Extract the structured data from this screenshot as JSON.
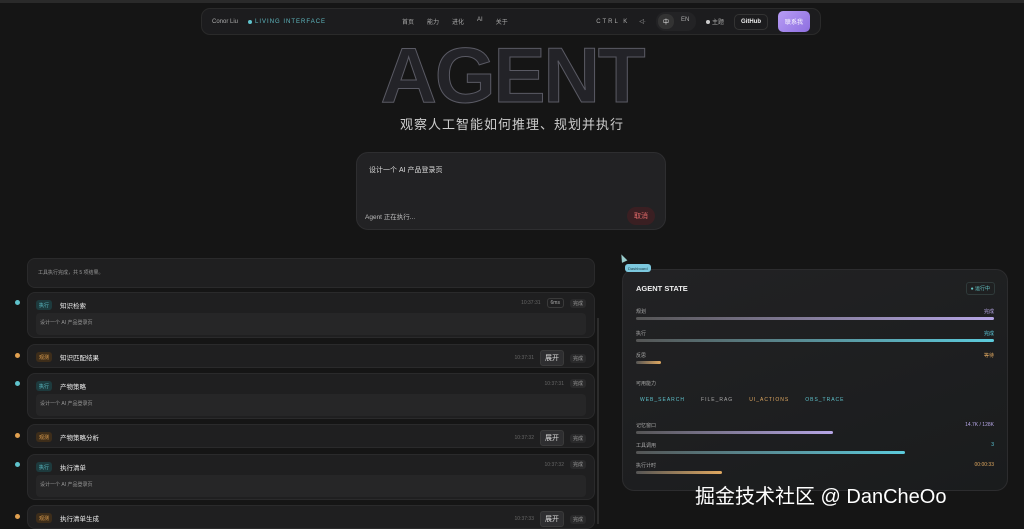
{
  "nav": {
    "brand": "Conor Liu",
    "live": "LIVING INTERFACE",
    "links": [
      "首页",
      "能力",
      "进化",
      "AI",
      "关于"
    ],
    "shortcut": "CTRL  K",
    "sound": "◁·",
    "lang": [
      "中",
      "EN"
    ],
    "theme": "主题",
    "github": "GitHub",
    "cta": "联系我"
  },
  "hero": {
    "title": "AGENT",
    "subtitle": "观察人工智能如何推理、规划并执行"
  },
  "prompt": {
    "value": "设计一个 AI 产品登录页",
    "status": "Agent 正在执行...",
    "cancel": "取消"
  },
  "timeline": [
    {
      "body": "工具执行完成，共 5 项结果。"
    },
    {
      "badge": "执行",
      "title": "知识检索",
      "time": "10:37:31",
      "duration": "6ms",
      "status": "完成",
      "body": "设计一个 AI 产品登录页"
    },
    {
      "badge": "观测",
      "title": "知识匹配结果",
      "time": "10:37:31",
      "action": "展开",
      "status": "完成"
    },
    {
      "badge": "执行",
      "title": "产物策略",
      "time": "10:37:31",
      "status": "完成",
      "body": "设计一个 AI 产品登录页"
    },
    {
      "badge": "观测",
      "title": "产物策略分析",
      "time": "10:37:32",
      "action": "展开",
      "status": "完成"
    },
    {
      "badge": "执行",
      "title": "执行清单",
      "time": "10:37:32",
      "status": "完成",
      "body": "设计一个 AI 产品登录页"
    },
    {
      "badge": "观测",
      "title": "执行清单生成",
      "time": "10:37:33",
      "action": "展开",
      "status": "完成"
    }
  ],
  "state": {
    "tag": "Dashboard",
    "title": "AGENT STATE",
    "running": "运行中",
    "phases": [
      {
        "label": "规划",
        "status": "完成",
        "progress": 100,
        "color": "#b6a6e6"
      },
      {
        "label": "执行",
        "status": "完成",
        "progress": 100,
        "color": "#5ccbdc"
      },
      {
        "label": "反思",
        "status": "等待",
        "progress": 7,
        "color": "#e0a860"
      }
    ],
    "caps_label": "可用能力",
    "caps": [
      {
        "name": "WEB_SEARCH",
        "color": "#5fc3cc"
      },
      {
        "name": "FILE_RAG",
        "color": "#aaaaaa"
      },
      {
        "name": "UI_ACTIONS",
        "color": "#e0a860"
      },
      {
        "name": "OBS_TRACE",
        "color": "#5fc3cc"
      }
    ],
    "metrics": [
      {
        "label": "记忆窗口",
        "value": "14.7K / 128K",
        "progress": 55,
        "color": "#b6a6e6"
      },
      {
        "label": "工具调用",
        "value": "3",
        "progress": 75,
        "color": "#5ccbdc"
      },
      {
        "label": "执行计时",
        "value": "00:00:33",
        "progress": 24,
        "color": "#e0a860"
      }
    ]
  },
  "watermark": "掘金技术社区 @ DanCheOo"
}
